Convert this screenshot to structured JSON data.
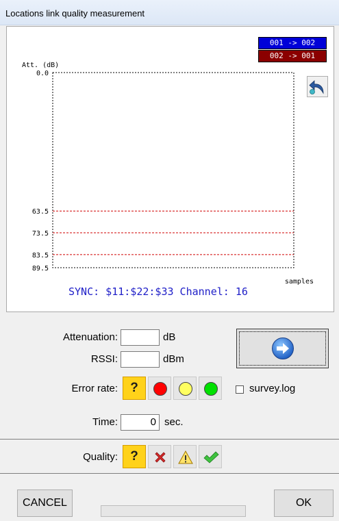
{
  "window": {
    "title": "Locations link quality measurement"
  },
  "chart_data": {
    "type": "line",
    "ylabel": "Att. (dB)",
    "xlabel": "samples",
    "ylim": [
      0.0,
      89.5
    ],
    "y_ticks": [
      "0.0",
      "63.5",
      "73.5",
      "83.5",
      "89.5"
    ],
    "y_tick_values": [
      0.0,
      63.5,
      73.5,
      83.5,
      89.5
    ],
    "threshold_lines": [
      63.5,
      73.5,
      83.5
    ],
    "threshold_color": "#d00000",
    "series": [
      {
        "name": "001 -> 002",
        "values": [],
        "color": "#0000d8"
      },
      {
        "name": "002 -> 001",
        "values": [],
        "color": "#8b0000"
      }
    ],
    "grid": false,
    "legend_placement": "top-right",
    "footer": "SYNC: $11:$22:$33 Channel: 16"
  },
  "form": {
    "attenuation": {
      "label": "Attenuation:",
      "value": "",
      "unit": "dB"
    },
    "rssi": {
      "label": "RSSI:",
      "value": "",
      "unit": "dBm"
    },
    "error_rate": {
      "label": "Error rate:",
      "unknown_symbol": "?",
      "options": [
        "red",
        "yellow",
        "green"
      ]
    },
    "survey_log": {
      "label": "survey.log",
      "checked": false
    },
    "time": {
      "label": "Time:",
      "value": "0",
      "unit": "sec."
    },
    "quality": {
      "label": "Quality:",
      "unknown_symbol": "?"
    }
  },
  "icons": {
    "next": "arrow-right-circle-icon",
    "undo": "undo-arrow-icon",
    "bad": "red-x-icon",
    "warn": "warning-triangle-icon",
    "good": "green-check-icon"
  },
  "buttons": {
    "cancel": "CANCEL",
    "ok": "OK"
  },
  "progress": {
    "fraction": 0.0
  }
}
